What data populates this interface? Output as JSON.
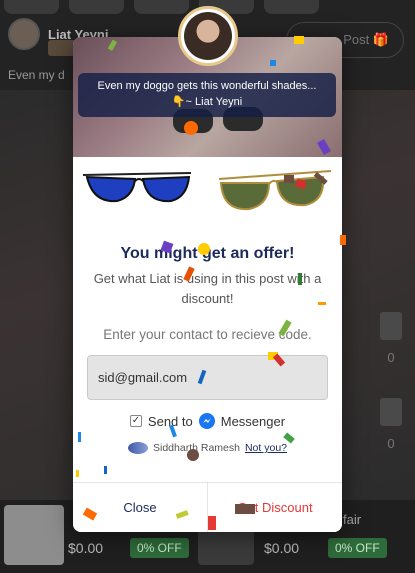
{
  "background": {
    "username": "Liat Yeyni",
    "caption": "Even my d",
    "post_button": "Post 🎁",
    "side_counts": [
      "0",
      "0"
    ],
    "products": [
      {
        "price": "$0.00",
        "off": "0% OFF"
      },
      {
        "price": "$0.00",
        "off": "0% OFF",
        "label": "fair"
      }
    ]
  },
  "modal": {
    "quote_text": "Even my doggo gets this wonderful shades...",
    "quote_author": "👇~ Liat Yeyni",
    "title": "You might get an offer!",
    "subtitle": "Get what Liat is using in this post with a discount!",
    "contact_label": "Enter your contact to recieve code.",
    "contact_value": "sid@gmail.com",
    "send_to_label": "Send to",
    "messenger_label": "Messenger",
    "user_name": "Siddharth Ramesh",
    "not_you": "Not you?",
    "close_label": "Close",
    "discount_label": "Get Discount"
  },
  "colors": {
    "accent_navy": "#1d2a5c",
    "discount_red": "#e53935",
    "messenger_blue": "#1877f2",
    "offer_green": "#2e6b3a"
  }
}
